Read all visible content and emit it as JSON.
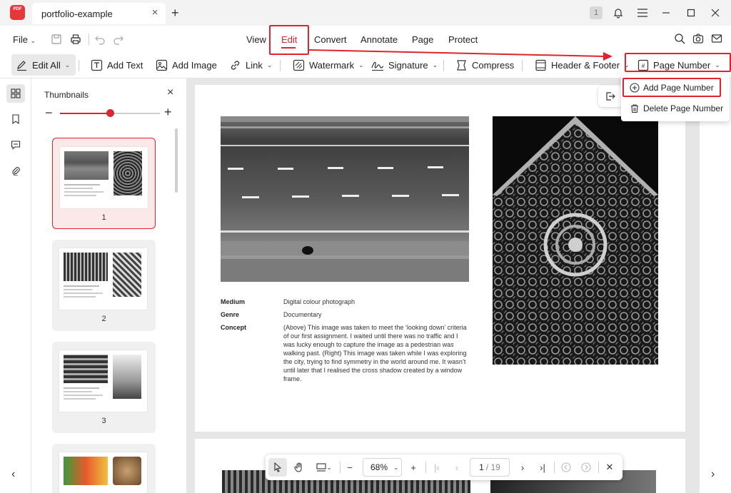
{
  "titlebar": {
    "logo_text": "PDF",
    "tab_title": "portfolio-example",
    "badge": "1"
  },
  "menubar": {
    "file_label": "File",
    "tabs": [
      "View",
      "Edit",
      "Convert",
      "Annotate",
      "Page",
      "Protect"
    ],
    "active_tab": "Edit"
  },
  "toolbar": {
    "edit_all": "Edit All",
    "add_text": "Add Text",
    "add_image": "Add Image",
    "link": "Link",
    "watermark": "Watermark",
    "signature": "Signature",
    "compress": "Compress",
    "header_footer": "Header & Footer",
    "page_number": "Page Number"
  },
  "dropdown": {
    "add_page_number": "Add Page Number",
    "delete_page_number": "Delete Page Number"
  },
  "thumbnails": {
    "title": "Thumbnails",
    "zoom_level": 0.5,
    "pages": [
      "1",
      "2",
      "3"
    ],
    "selected_page": "1"
  },
  "document": {
    "labels": {
      "medium": "Medium",
      "genre": "Genre",
      "concept": "Concept"
    },
    "values": {
      "medium": "Digital colour photograph",
      "genre": "Documentary",
      "concept": "(Above) This image was taken to meet the ‘looking down’ criteria of our first assignment. I waited until there was no traffic and I was lucky enough to capture the image as a pedestrian was walking past. (Right) This image was taken while I was exploring the city, trying to find symmetry in the world around me. It wasn’t until later that I realised the cross shadow created by a window frame."
    }
  },
  "bottombar": {
    "zoom": "68%",
    "current_page": "1",
    "total_pages": "/ 19"
  },
  "colors": {
    "accent": "#e0242d"
  }
}
